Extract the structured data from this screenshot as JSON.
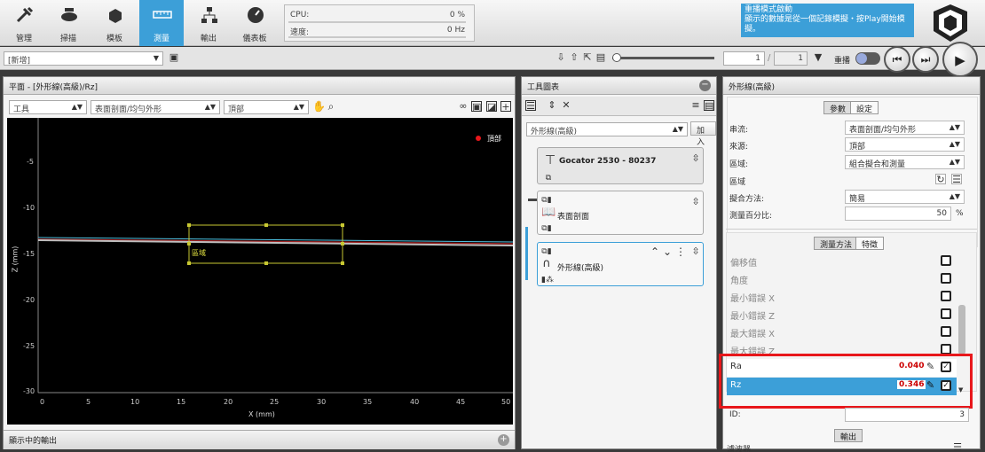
{
  "toolbar": {
    "items": [
      {
        "label": "管理",
        "icon": "tools-icon"
      },
      {
        "label": "掃描",
        "icon": "scan-icon"
      },
      {
        "label": "模板",
        "icon": "cubes-icon"
      },
      {
        "label": "測量",
        "icon": "ruler-icon",
        "active": true
      },
      {
        "label": "輸出",
        "icon": "network-icon"
      },
      {
        "label": "儀表板",
        "icon": "gauge-icon"
      }
    ],
    "cpu_label": "CPU:",
    "cpu_value": "0 %",
    "speed_label": "速度:",
    "speed_value": "0 Hz",
    "notice_title": "重播模式啟動",
    "notice_text": "顯示的數據是從一個記錄模擬・按Play開始模擬。"
  },
  "bar2": {
    "job_select": "[新增]",
    "frame_value": "1",
    "frame_total": "1",
    "replay_label": "重播"
  },
  "left_panel": {
    "title": "平面 - [外形線(高級)/Rz]",
    "select1": "工具",
    "select2": "表面剖面/均勻外形",
    "select3": "頂部",
    "legend_label": "頂部",
    "region_label": "區域",
    "x_axis_label": "X (mm)",
    "y_axis_label": "Z (mm)",
    "x_ticks": [
      "0",
      "5",
      "10",
      "15",
      "20",
      "25",
      "30",
      "35",
      "40",
      "45",
      "50"
    ],
    "y_ticks": [
      "-5",
      "-10",
      "-15",
      "-20",
      "-25",
      "-30"
    ],
    "footer": "顯示中的輸出"
  },
  "tools_panel": {
    "title": "工具圖表",
    "tool_select": "外形線(高級)",
    "add_button": "加入",
    "sensor_card": "Gocator 2530 - 80237",
    "card2_label": "表面剖面",
    "card3_label": "外形線(高級)"
  },
  "props_panel": {
    "title": "外形線(高級)",
    "tab_params": "參數",
    "tab_settings": "設定",
    "rows": [
      {
        "k": "串流:",
        "v": "表面剖面/均勻外形"
      },
      {
        "k": "來源:",
        "v": "頂部"
      },
      {
        "k": "區域:",
        "v": "組合擬合和測量"
      }
    ],
    "region_row": "區域",
    "fit_label": "擬合方法:",
    "fit_value": "簡易",
    "percent_label": "測量百分比:",
    "percent_value": "50",
    "percent_unit": "%",
    "tab_measure": "測量方法",
    "tab_feature": "特徵",
    "measurements": [
      {
        "label": "偏移值"
      },
      {
        "label": "角度"
      },
      {
        "label": "最小錯誤 X"
      },
      {
        "label": "最小錯誤 Z"
      },
      {
        "label": "最大錯誤 X"
      },
      {
        "label": "最大錯誤 Z"
      }
    ],
    "ra_label": "Ra",
    "ra_value": "0.040",
    "rz_label": "Rz",
    "rz_value": "0.346",
    "id_label": "ID:",
    "id_value": "3",
    "output_label": "輸出",
    "filter_label": "濾波器"
  },
  "colors": {
    "accent": "#3c9fd8",
    "highlight": "#e8171b",
    "value_red": "#cc0000",
    "region_yellow": "#c8c832"
  }
}
